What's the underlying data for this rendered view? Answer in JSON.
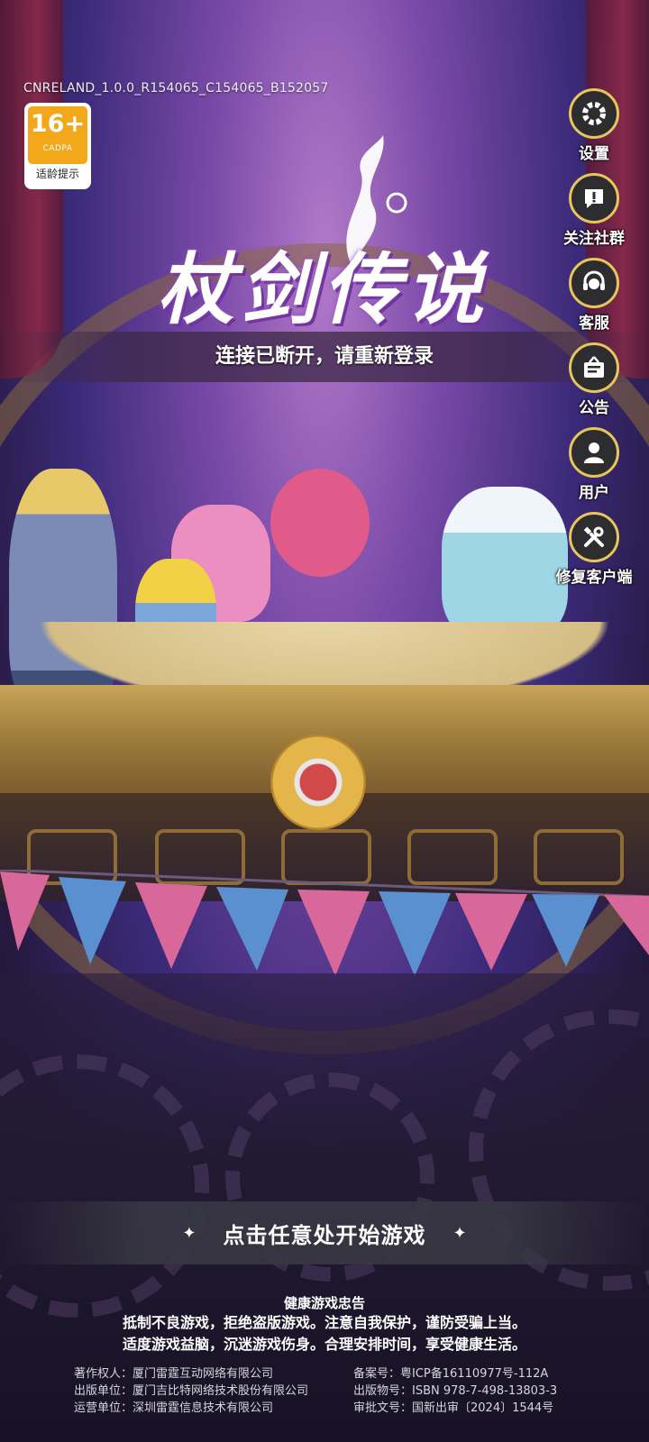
{
  "version": "CNRELAND_1.0.0_R154065_C154065_B152057",
  "age_rating": {
    "number": "16+",
    "org": "CADPA",
    "tip": "适龄提示"
  },
  "game_title": "杖剑传说",
  "status_message": "连接已断开，请重新登录",
  "side_menu": [
    {
      "label": "设置",
      "icon": "gear-icon"
    },
    {
      "label": "关注社群",
      "icon": "chat-alert-icon"
    },
    {
      "label": "客服",
      "icon": "headset-icon"
    },
    {
      "label": "公告",
      "icon": "notice-board-icon"
    },
    {
      "label": "用户",
      "icon": "user-icon"
    },
    {
      "label": "修复客户端",
      "icon": "tools-icon"
    }
  ],
  "start_prompt": "点击任意处开始游戏",
  "health_notice": {
    "title": "健康游戏忠告",
    "line1": "抵制不良游戏，拒绝盗版游戏。注意自我保护，谨防受骗上当。",
    "line2": "适度游戏益脑，沉迷游戏伤身。合理安排时间，享受健康生活。"
  },
  "credits_left": [
    "著作权人：厦门雷霆互动网络有限公司",
    "出版单位：厦门吉比特网络技术股份有限公司",
    "运营单位：深圳雷霆信息技术有限公司"
  ],
  "credits_right": [
    "备案号：粤ICP备16110977号-112A",
    "出版物号：ISBN 978-7-498-13803-3",
    "审批文号：国新出审〔2024〕1544号"
  ],
  "colors": {
    "badge_orange": "#f3a81c",
    "menu_ring": "#e6c65a",
    "menu_bg": "#2d2d30"
  }
}
